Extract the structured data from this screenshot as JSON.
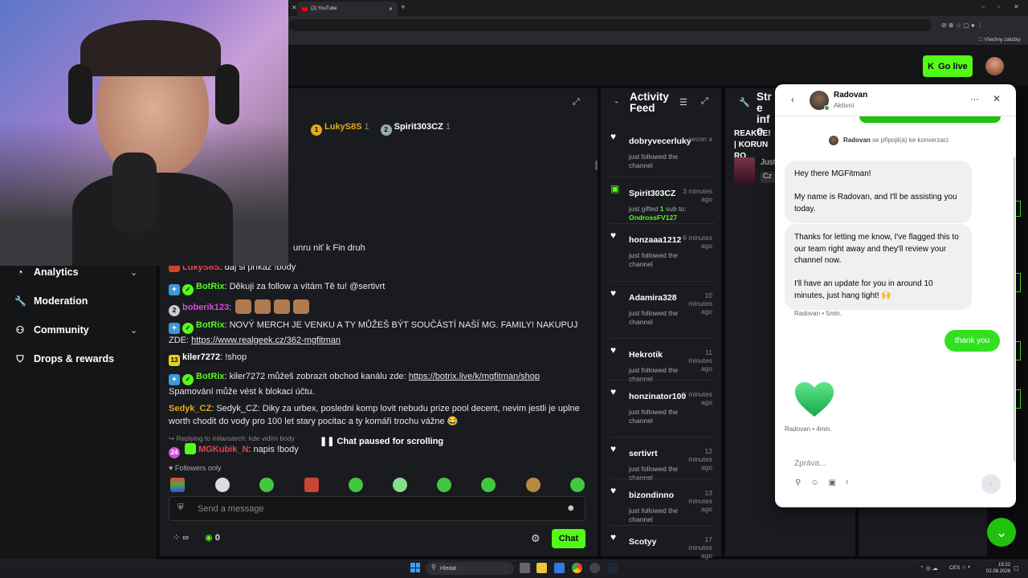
{
  "browser": {
    "tabs": [
      {
        "label": ""
      },
      {
        "label": "(2) YouTube"
      }
    ],
    "bookmarks_label": "Všechny záložky"
  },
  "topbar": {
    "go_live_label": "Go live"
  },
  "sidebar": {
    "items": [
      {
        "label": "Analytics",
        "icon": "chart-icon",
        "expandable": true
      },
      {
        "label": "Moderation",
        "icon": "wrench-icon",
        "expandable": false
      },
      {
        "label": "Community",
        "icon": "community-icon",
        "expandable": true
      },
      {
        "label": "Drops & rewards",
        "icon": "gift-icon",
        "expandable": false
      }
    ]
  },
  "chat": {
    "gifters": [
      {
        "rank": "1",
        "name": "LukyS8S",
        "count": "1"
      },
      {
        "rank": "2",
        "name": "Spirit303CZ",
        "count": "1"
      }
    ],
    "partial_line": "unru niť k Fin druh",
    "messages": [
      {
        "user": "LukyS8S",
        "text": ": daj si příkaz !body"
      },
      {
        "user": "BotRix",
        "text": ": Děkuji za follow a vítám Tě tu! @sertivrt"
      },
      {
        "user": "boberik123",
        "text": ":"
      },
      {
        "user": "BotRix",
        "text": ": NOVÝ MERCH JE VENKU A TY MŮŽEŠ BÝT SOUČÁSTÍ NAŠÍ MG. FAMILY! NAKUPUJ ZDE: ",
        "link": "https://www.realgeek.cz/362-mgfitman"
      },
      {
        "badge": "13",
        "user": "kiler7272",
        "text": ": !shop"
      },
      {
        "user": "BotRix",
        "text": ": kiler7272 můžeš zobrazit obchod kanálu zde: ",
        "link": "https://botrix.live/k/mgfitman/shop",
        "after": "Spamování může vést k blokaci účtu."
      },
      {
        "user": "Sedyk_CZ",
        "text": ": Sedyk_CZ: Diky za urbex, posledni komp lovit nebudu prize pool decent, nevim jestli je uplne worth chodit do vody pro 100 let stary pocitac a ty komáři trochu vážne"
      },
      {
        "badge": "24",
        "user": "MGKubik_N",
        "text": ": napis !body"
      }
    ],
    "reply_to": "Replying to milanstech: kde vidím body",
    "paused_label": "Chat paused for scrolling",
    "followers_only": "Followers only",
    "input_placeholder": "Send a message",
    "viewer_count": "∞",
    "kick_count": "0",
    "send_label": "Chat"
  },
  "activity": {
    "title_line1": "Activity",
    "title_line2": "Feed",
    "items": [
      {
        "name": "dobryvecerluky",
        "time": "secon a",
        "desc": "just followed the channel",
        "icon": "heart"
      },
      {
        "name": "Spirit303CZ",
        "time": "3 minutes ago",
        "desc": "just gifted",
        "gift_count": "1",
        "desc2": "sub to:",
        "recipient": "OndrossFV127",
        "icon": "gift"
      },
      {
        "name": "honzaaa1212",
        "time": "6 minutes ago",
        "desc": "just followed the channel",
        "icon": "heart"
      },
      {
        "name": "Adamira328",
        "time": "10 minutes ago",
        "desc": "just followed the channel",
        "icon": "heart"
      },
      {
        "name": "Hekrotik",
        "time": "11 minutes ago",
        "desc": "just followed the channel",
        "icon": "heart"
      },
      {
        "name": "honzinator100",
        "time": "1' minutes ago",
        "desc": "just followed the channel",
        "icon": "heart"
      },
      {
        "name": "sertivrt",
        "time": "12 minutes ago",
        "desc": "just followed the channel",
        "icon": "heart"
      },
      {
        "name": "bizondinno",
        "time": "13 minutes ago",
        "desc": "just followed the channel",
        "icon": "heart"
      },
      {
        "name": "Scotyy",
        "time": "17 minutes ago",
        "desc": "",
        "icon": "heart"
      }
    ]
  },
  "stream_info": {
    "title_partial": "Stre info",
    "headline": "REAKCE! | KORUN RO",
    "category_partial": "Just",
    "tag_partial": "Cz"
  },
  "messenger": {
    "agent_name": "Radovan",
    "status": "Aktivní",
    "joined_name": "Radovan",
    "joined_text": "se připojil(a) ke konverzaci",
    "msg1_line1": "Hey there MGFitman!",
    "msg1_line2": "My name is Radovan, and I'll be assisting you today.",
    "msg2_line1": "Thanks for letting me know, I've flagged this to our team right away and they'll review your channel now.",
    "msg2_line2": "I'll have an update for you in around 10 minutes, just hang tight! 🙌",
    "meta1": "Radovan • 5min.",
    "reply": "thank you",
    "meta2": "Radovan • 4min.",
    "input_placeholder": "Zpráva..."
  },
  "taskbar": {
    "search_label": "Hledat",
    "lang": "CES",
    "time": "19:22",
    "date": "02.08.2026"
  },
  "colors": {
    "kick_green": "#53fc18",
    "botrix_blue": "#3a9ad9",
    "panel_bg": "#191b1f",
    "messenger_green": "#20c20e"
  }
}
